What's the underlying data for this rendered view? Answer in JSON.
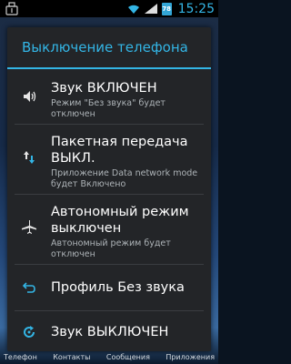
{
  "status_bar": {
    "time": "15:25",
    "battery_level": "78",
    "left_icon": "usb-icon",
    "icons": [
      "wifi-icon",
      "signal-icon",
      "battery-icon"
    ]
  },
  "dialog": {
    "title": "Выключение телефона",
    "accent_color": "#33b5e5",
    "items": [
      {
        "icon": "sound-on-icon",
        "label": "Звук ВКЛЮЧЕН",
        "sublabel": "Режим \"Без звука\" будет отключен"
      },
      {
        "icon": "data-transfer-icon",
        "label": "Пакетная передача ВЫКЛ.",
        "sublabel": "Приложение Data network mode будет Включено"
      },
      {
        "icon": "airplane-icon",
        "label": "Автономный режим выключен",
        "sublabel": "Автономный режим будет отключен"
      },
      {
        "icon": "profile-return-icon",
        "label": "Профиль Без звука",
        "sublabel": ""
      },
      {
        "icon": "refresh-icon",
        "label": "Звук ВЫКЛЮЧЕН",
        "sublabel": ""
      }
    ]
  },
  "dock": {
    "labels": [
      "Телефон",
      "Контакты",
      "Сообщения",
      "Приложения"
    ]
  }
}
